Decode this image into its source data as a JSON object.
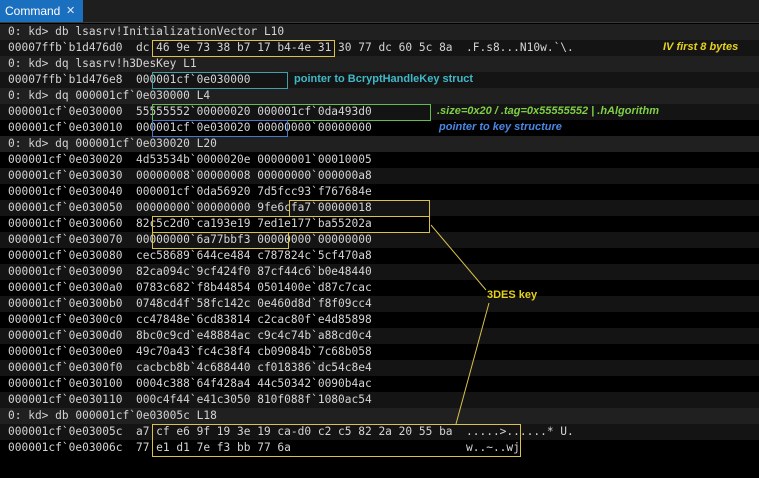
{
  "window": {
    "tab_title": "Command",
    "close_glyph": "✕"
  },
  "colors": {
    "tab_active": "#1a6fbf",
    "yellow_box": "#d9c14a",
    "teal_box": "#3fa0a8",
    "green_box": "#5fbf4a",
    "blue_box": "#4a78c8",
    "annot_yellow": "#e6d21c",
    "annot_teal": "#3fb8c8",
    "annot_green": "#7fd045",
    "annot_blue": "#4a88e6"
  },
  "lines": [
    "0: kd> db lsasrv!InitializationVector L10",
    "00007ffb`b1d476d0  dc 46 9e 73 38 b7 17 b4-4e 31 30 77 dc 60 5c 8a  .F.s8...N10w.`\\.",
    "0: kd> dq lsasrv!h3DesKey L1",
    "00007ffb`b1d476e8  000001cf`0e030000",
    "0: kd> dq 000001cf`0e030000 L4",
    "000001cf`0e030000  55555552`00000020 000001cf`0da493d0",
    "000001cf`0e030010  000001cf`0e030020 00000000`00000000",
    "0: kd> dq 000001cf`0e030020 L20",
    "000001cf`0e030020  4d53534b`0000020e 00000001`00010005",
    "000001cf`0e030030  00000008`00000008 00000000`000000a8",
    "000001cf`0e030040  000001cf`0da56920 7d5fcc93`f767684e",
    "000001cf`0e030050  00000000`00000000 9fe6cfa7`00000018",
    "000001cf`0e030060  82c5c2d0`ca193e19 7ed1e177`ba55202a",
    "000001cf`0e030070  00000000`6a77bbf3 00000000`00000000",
    "000001cf`0e030080  cec58689`644ce484 c787824c`5cf470a8",
    "000001cf`0e030090  82ca094c`9cf424f0 87cf44c6`b0e48440",
    "000001cf`0e0300a0  0783c682`f8b44854 0501400e`d87c7cac",
    "000001cf`0e0300b0  0748cd4f`58fc142c 0e460d8d`f8f09cc4",
    "000001cf`0e0300c0  cc47848e`6cd83814 c2cac80f`e4d85898",
    "000001cf`0e0300d0  8bc0c9cd`e48884ac c9c4c74b`a88cd0c4",
    "000001cf`0e0300e0  49c70a43`fc4c38f4 cb09084b`7c68b058",
    "000001cf`0e0300f0  cacbcb8b`4c688440 cf018386`dc54c8e4",
    "000001cf`0e030100  0004c388`64f428a4 44c50342`0090b4ac",
    "000001cf`0e030110  000c4f44`e41c3050 810f088f`1080ac54",
    "0: kd> db 000001cf`0e03005c L18",
    "000001cf`0e03005c  a7 cf e6 9f 19 3e 19 ca-d0 c2 c5 82 2a 20 55 ba  .....>......* U.",
    "000001cf`0e03006c  77 e1 d1 7e f3 bb 77 6a                          w..~..wj"
  ],
  "annotations": {
    "iv": "IV first 8 bytes",
    "bcrypt": "pointer to BcryptHandleKey struct",
    "struct": ".size=0x20 / .tag=0x55555552 | .hAlgorithm",
    "keystruct": "pointer to key structure",
    "des": "3DES key"
  }
}
